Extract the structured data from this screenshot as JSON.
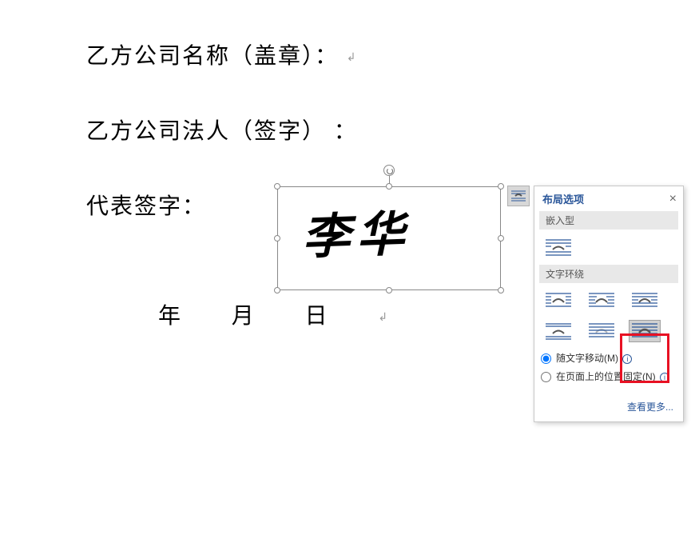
{
  "document": {
    "line1": "乙方公司名称（盖章）：",
    "line2": "乙方公司法人（签字） ：",
    "line3_label": "代表签字：",
    "signature_value": "李华",
    "date_label": "年 月 日"
  },
  "layout_panel": {
    "title": "布局选项",
    "section_inline": "嵌入型",
    "section_wrap": "文字环绕",
    "radio_move_with_text": "随文字移动(M)",
    "radio_fixed_position": "在页面上的位置固定(N)",
    "see_more": "查看更多..."
  },
  "icons": {
    "inline": "inline-with-text",
    "wrap_square": "square",
    "wrap_tight": "tight",
    "wrap_through": "through",
    "wrap_topbottom": "top-and-bottom",
    "wrap_behind": "behind-text",
    "wrap_front": "in-front-of-text"
  }
}
